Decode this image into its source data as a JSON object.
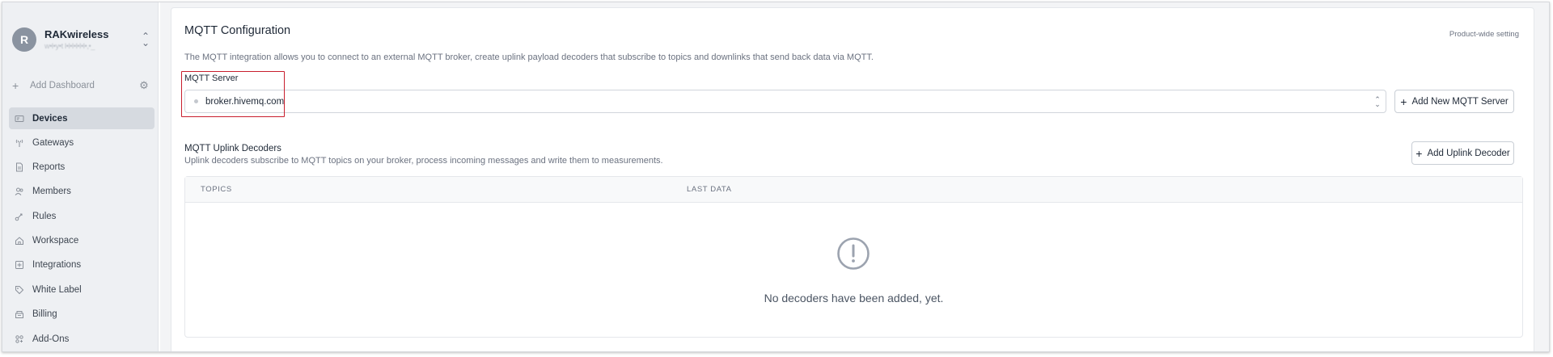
{
  "org": {
    "initial": "R",
    "name": "RAKwireless",
    "subtitle": "w•l•y•t l•l•l•l•l•l•,•_"
  },
  "sidebar": {
    "add_dashboard": "Add Dashboard",
    "items": [
      {
        "label": "Devices",
        "icon": "devices-icon",
        "active": true
      },
      {
        "label": "Gateways",
        "icon": "gateway-icon"
      },
      {
        "label": "Reports",
        "icon": "reports-icon"
      },
      {
        "label": "Members",
        "icon": "members-icon"
      },
      {
        "label": "Rules",
        "icon": "rules-icon"
      },
      {
        "label": "Workspace",
        "icon": "workspace-icon"
      },
      {
        "label": "Integrations",
        "icon": "integrations-icon"
      },
      {
        "label": "White Label",
        "icon": "tag-icon"
      },
      {
        "label": "Billing",
        "icon": "billing-icon"
      },
      {
        "label": "Add-Ons",
        "icon": "addons-icon"
      }
    ]
  },
  "main": {
    "title": "MQTT Configuration",
    "product_wide": "Product-wide setting",
    "description": "The MQTT integration allows you to connect to an external MQTT broker, create uplink payload decoders that subscribe to topics and downlinks that send back data via MQTT.",
    "server_label": "MQTT Server",
    "server_value": "broker.hivemq.com",
    "add_server_button": "Add New MQTT Server",
    "decoders_title": "MQTT Uplink Decoders",
    "decoders_description": "Uplink decoders subscribe to MQTT topics on your broker, process incoming messages and write them to measurements.",
    "add_decoder_button": "Add Uplink Decoder",
    "table": {
      "columns": [
        "TOPICS",
        "LAST DATA"
      ],
      "empty_message": "No decoders have been added, yet."
    }
  },
  "colors": {
    "accent_highlight": "#c81e2d",
    "sidebar_bg": "#eef0f3",
    "active_item_bg": "#d6dae0"
  }
}
